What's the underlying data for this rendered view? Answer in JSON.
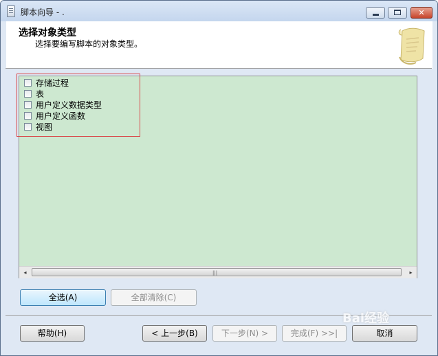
{
  "window": {
    "title": "脚本向导 - ."
  },
  "header": {
    "title": "选择对象类型",
    "subtitle": "选择要编写脚本的对象类型。"
  },
  "object_types": [
    {
      "label": "存储过程",
      "checked": false
    },
    {
      "label": "表",
      "checked": false
    },
    {
      "label": "用户定义数据类型",
      "checked": false
    },
    {
      "label": "用户定义函数",
      "checked": false
    },
    {
      "label": "视图",
      "checked": false
    }
  ],
  "scrollbar": {
    "left_arrow": "◂",
    "right_arrow": "▸",
    "grip": "|||"
  },
  "buttons": {
    "select_all": "全选(A)",
    "clear_all": "全部清除(C)",
    "help": "帮助(H)",
    "back": "< 上一步(B)",
    "next": "下一步(N) >",
    "finish": "完成(F) >>|",
    "cancel": "取消"
  },
  "watermark": {
    "text": "Bai经验"
  },
  "colors": {
    "list_background": "#cde8d0",
    "highlight_box": "#d9494b"
  }
}
